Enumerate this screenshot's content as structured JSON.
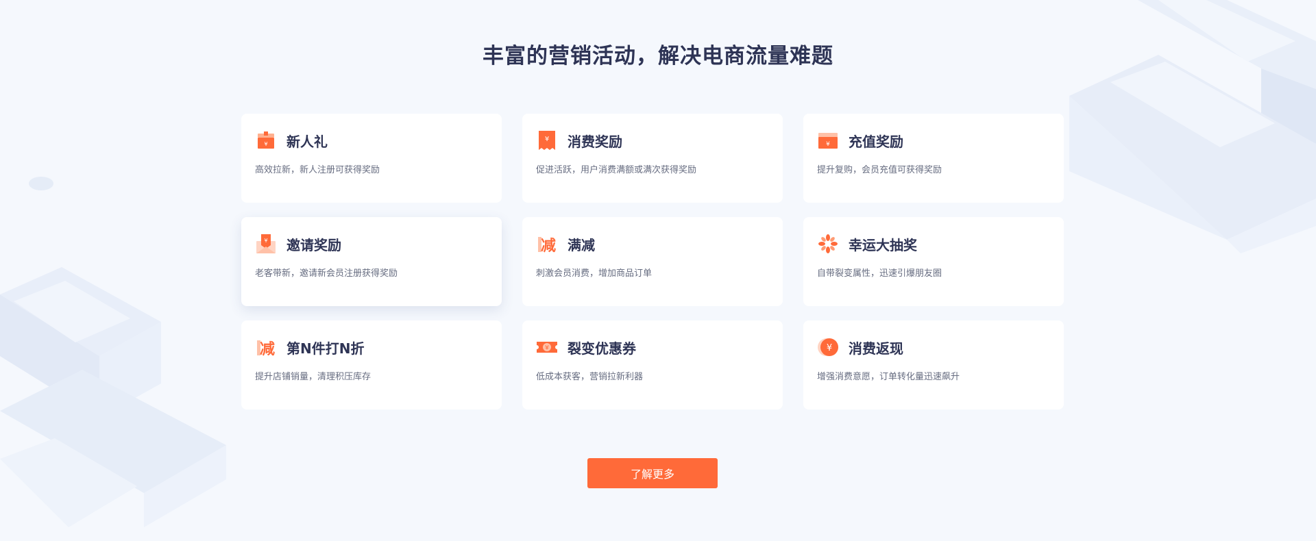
{
  "section": {
    "title": "丰富的营销活动，解决电商流量难题"
  },
  "theme": {
    "accent": "#ff6a39",
    "title_color": "#2e3455",
    "desc_color": "#666c80",
    "background": "#f5f8fd"
  },
  "cards": [
    {
      "title": "新人礼",
      "desc": "高效拉新，新人注册可获得奖励",
      "icon": "gift-box-icon"
    },
    {
      "title": "消费奖励",
      "desc": "促进活跃，用户消费满额或满次获得奖励",
      "icon": "receipt-yen-icon"
    },
    {
      "title": "充值奖励",
      "desc": "提升复购，会员充值可获得奖励",
      "icon": "wallet-yen-icon"
    },
    {
      "title": "邀请奖励",
      "desc": "老客带新，邀请新会员注册获得奖励",
      "icon": "envelope-yen-icon"
    },
    {
      "title": "满减",
      "desc": "刺激会员消费，增加商品订单",
      "icon": "discount-tag-icon"
    },
    {
      "title": "幸运大抽奖",
      "desc": "自带裂变属性，迅速引爆朋友圈",
      "icon": "pinwheel-icon"
    },
    {
      "title": "第N件打N折",
      "desc": "提升店铺销量，清理积压库存",
      "icon": "discount-tag-icon"
    },
    {
      "title": "裂变优惠券",
      "desc": "低成本获客，营销拉新利器",
      "icon": "coupon-icon"
    },
    {
      "title": "消费返现",
      "desc": "增强消费意愿，订单转化量迅速飙升",
      "icon": "cashback-coin-icon"
    }
  ],
  "active_card_index": 3,
  "cta": {
    "label": "了解更多"
  }
}
